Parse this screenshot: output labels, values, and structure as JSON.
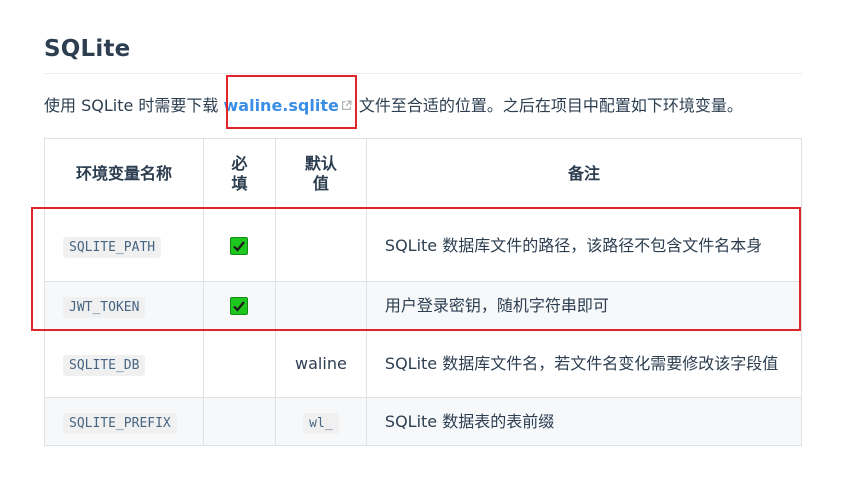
{
  "section": {
    "title": "SQLite"
  },
  "intro": {
    "before": "使用 SQLite 时需要下载 ",
    "link_text": "waline.sqlite",
    "after": " 文件至合适的位置。之后在项目中配置如下环境变量。"
  },
  "table": {
    "headers": {
      "name": "环境变量名称",
      "required_line1": "必",
      "required_line2": "填",
      "default_line1": "默认",
      "default_line2": "值",
      "note": "备注"
    },
    "rows": [
      {
        "name": "SQLITE_PATH",
        "required": true,
        "default": "",
        "note": "SQLite 数据库文件的路径，该路径不包含文件名本身"
      },
      {
        "name": "JWT_TOKEN",
        "required": true,
        "default": "",
        "note": "用户登录密钥，随机字符串即可"
      },
      {
        "name": "SQLITE_DB",
        "required": false,
        "default": "waline",
        "note": "SQLite 数据库文件名，若文件名变化需要修改该字段值"
      },
      {
        "name": "SQLITE_PREFIX",
        "required": false,
        "default": "wl_",
        "note": "SQLite 数据表的表前缀"
      }
    ]
  },
  "icons": {
    "external_link": "external-link-icon",
    "checkmark": "check-mark-icon"
  },
  "colors": {
    "link": "#3a8ee6",
    "highlight": "#e0242b",
    "check": "#1ec71e"
  }
}
